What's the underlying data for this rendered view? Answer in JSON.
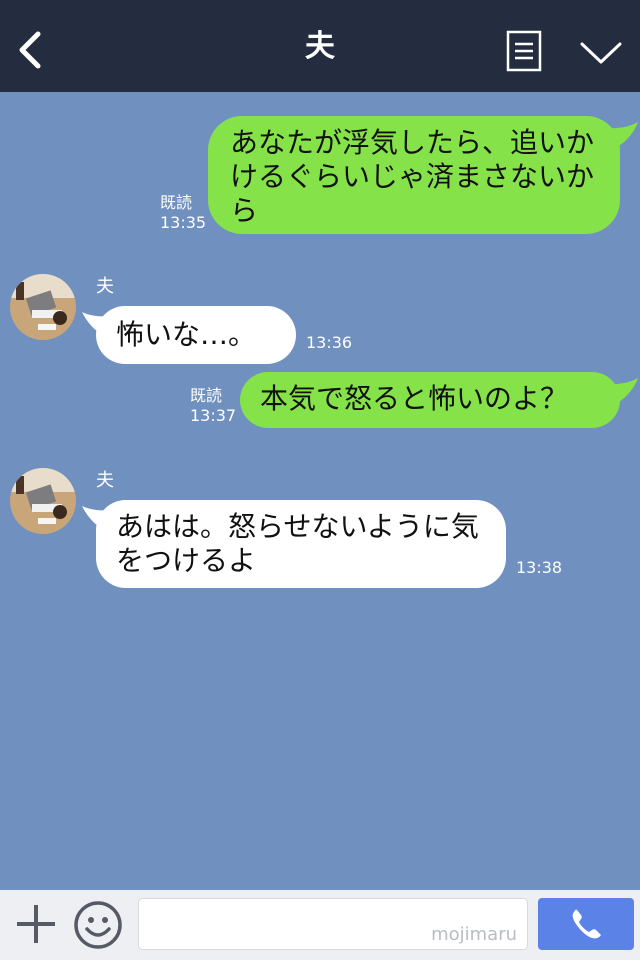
{
  "header": {
    "title": "夫",
    "icons": {
      "back": "chevron-left-icon",
      "menu": "list-icon",
      "collapse": "chevron-down-icon"
    }
  },
  "colors": {
    "header_bg": "#242c40",
    "chat_bg": "#7090bf",
    "sent_bubble": "#85e249",
    "received_bubble": "#ffffff",
    "call_button": "#5b82e6"
  },
  "messages": [
    {
      "side": "sent",
      "text": "あなたが浮気したら、追いかけるぐらいじゃ済まさないから",
      "read": "既読",
      "time": "13:35"
    },
    {
      "side": "received",
      "sender": "夫",
      "text": "怖いな…。",
      "time": "13:36"
    },
    {
      "side": "sent",
      "text": "本気で怒ると怖いのよ？",
      "read": "既読",
      "time": "13:37"
    },
    {
      "side": "received",
      "sender": "夫",
      "text": "あはは。怒らせないように気をつけるよ",
      "time": "13:38"
    }
  ],
  "input": {
    "placeholder": "",
    "watermark": "mojimaru",
    "icons": {
      "add": "plus-icon",
      "sticker": "smiley-icon",
      "call": "phone-icon"
    }
  }
}
